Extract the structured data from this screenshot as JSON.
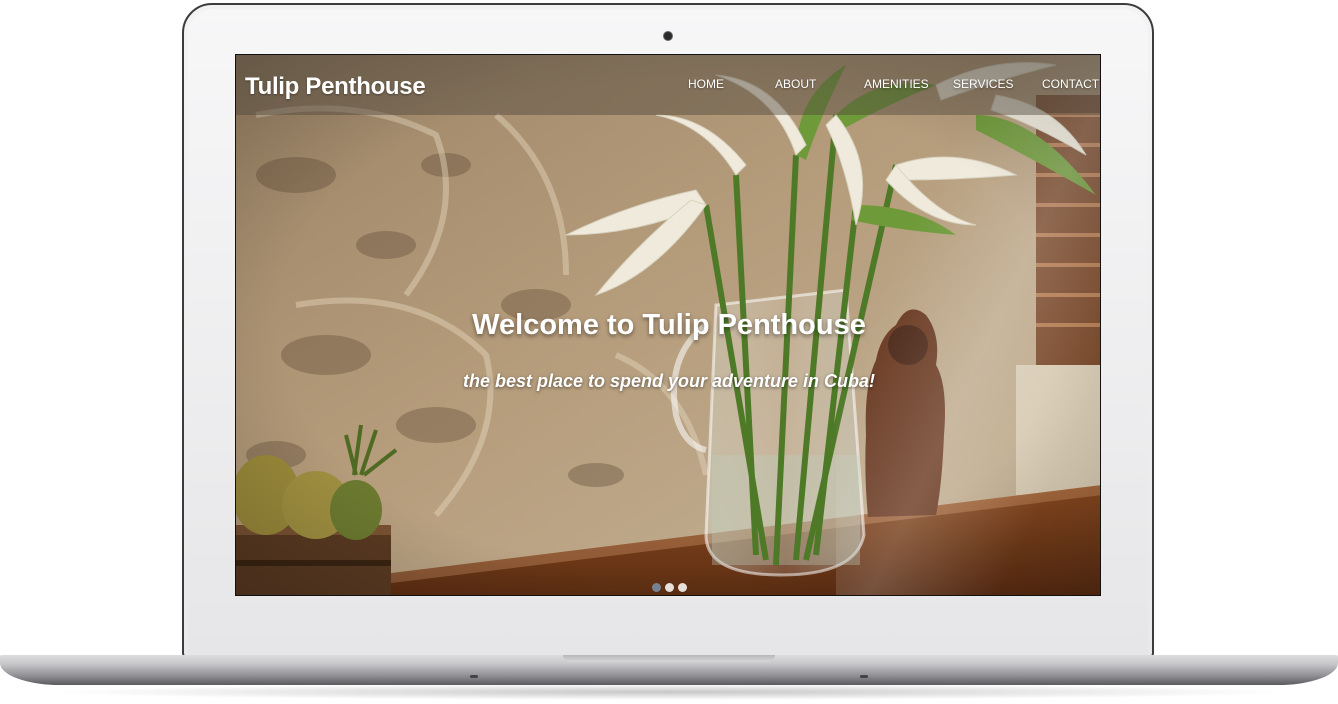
{
  "site": {
    "brand": "Tulip Penthouse",
    "nav": [
      {
        "label": "HOME"
      },
      {
        "label": "ABOUT"
      },
      {
        "label": "AMENITIES"
      },
      {
        "label": "SERVICES"
      },
      {
        "label": "CONTACT"
      }
    ],
    "hero": {
      "title": "Welcome to Tulip Penthouse",
      "subtitle": "the best place to spend your adventure in Cuba!",
      "carousel_slides": 3,
      "active_slide": 1
    }
  },
  "colors": {
    "nav_text": "#ffffff",
    "hero_text": "#ffffff",
    "laptop_frame": "#e9e9eb",
    "laptop_bezel": "#3c3c3e"
  }
}
